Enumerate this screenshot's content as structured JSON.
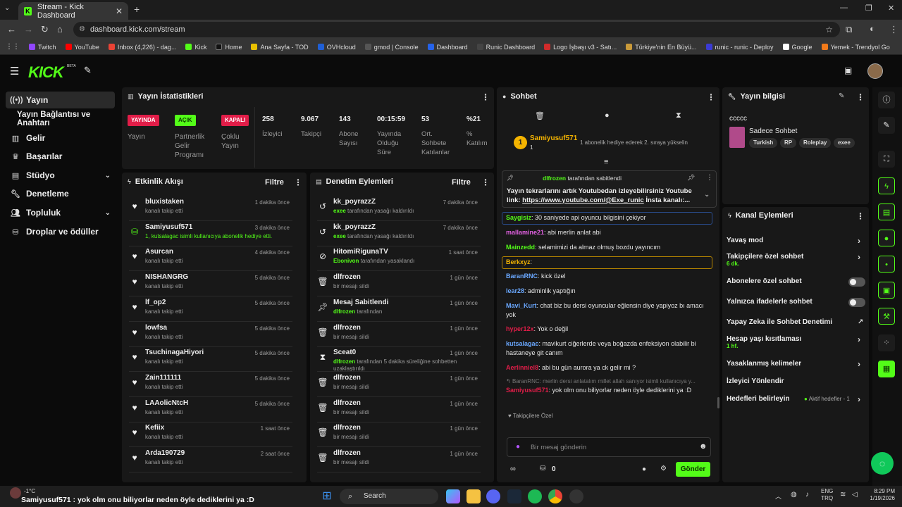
{
  "browser": {
    "tab_title": "Stream - Kick Dashboard",
    "url": "dashboard.kick.com/stream",
    "bookmarks": [
      "Twitch",
      "YouTube",
      "Inbox (4,226) - dag...",
      "Kick",
      "Home",
      "Ana Sayfa - TOD",
      "OVHcloud",
      "gmod | Console",
      "Dashboard",
      "Runic Dashboard",
      "Logo İşbaşı v3 - Satı...",
      "Türkiye'nin En Büyü...",
      "runic - runic - Deploy",
      "Google",
      "Yemek - Trendyol Go"
    ]
  },
  "app": {
    "logo": "KICK",
    "logo_badge": "BETA"
  },
  "sidebar": {
    "items": [
      {
        "label": "Yayın",
        "icon": "broadcast-icon"
      },
      {
        "label": "Yayın Bağlantısı ve Anahtarı",
        "icon": ""
      },
      {
        "label": "Gelir",
        "icon": "chart-icon"
      },
      {
        "label": "Başarılar",
        "icon": "trophy-icon"
      },
      {
        "label": "Stüdyo",
        "icon": "studio-icon"
      },
      {
        "label": "Denetleme",
        "icon": "wrench-icon"
      },
      {
        "label": "Topluluk",
        "icon": "community-icon"
      },
      {
        "label": "Droplar ve ödüller",
        "icon": "gift-icon"
      }
    ]
  },
  "stats": {
    "title": "Yayın İstatistikleri",
    "badges": [
      {
        "text": "YAYINDA",
        "label": "Yayın",
        "color": "#e11d48"
      },
      {
        "text": "AÇIK",
        "label": "Partnerlik Gelir Programı",
        "color": "#53fc18"
      },
      {
        "text": "KAPALI",
        "label": "Çoklu Yayın",
        "color": "#e11d48"
      }
    ],
    "values": [
      {
        "value": "258",
        "label": "İzleyici"
      },
      {
        "value": "9.067",
        "label": "Takipçi"
      },
      {
        "value": "143",
        "label": "Abone Sayısı"
      },
      {
        "value": "00:15:59",
        "label": "Yayında Olduğu Süre"
      },
      {
        "value": "53",
        "label": "Ort. Sohbete Katılanlar"
      },
      {
        "value": "%21",
        "label": "% Katılım"
      }
    ]
  },
  "activity": {
    "title": "Etkinlik Akışı",
    "filter": "Filtre",
    "rows": [
      {
        "name": "bluxistaken",
        "sub": "kanalı takip etti",
        "time": "1 dakika önce",
        "icon": "heart-icon"
      },
      {
        "name": "Samiyusuf571",
        "sub": "1, kutsalagac isimli kullanıcıya abonelik hediye etti.",
        "time": "3 dakika önce",
        "icon": "gift-icon"
      },
      {
        "name": "Asurcan",
        "sub": "kanalı takip etti",
        "time": "4 dakika önce",
        "icon": "heart-icon"
      },
      {
        "name": "NISHANGRG",
        "sub": "kanalı takip etti",
        "time": "5 dakika önce",
        "icon": "heart-icon"
      },
      {
        "name": "lf_op2",
        "sub": "kanalı takip etti",
        "time": "5 dakika önce",
        "icon": "heart-icon"
      },
      {
        "name": "lowfsa",
        "sub": "kanalı takip etti",
        "time": "5 dakika önce",
        "icon": "heart-icon"
      },
      {
        "name": "TsuchinagaHiyori",
        "sub": "kanalı takip etti",
        "time": "5 dakika önce",
        "icon": "heart-icon"
      },
      {
        "name": "Zain111111",
        "sub": "kanalı takip etti",
        "time": "5 dakika önce",
        "icon": "heart-icon"
      },
      {
        "name": "LAAolicNtcH",
        "sub": "kanalı takip etti",
        "time": "5 dakika önce",
        "icon": "heart-icon"
      },
      {
        "name": "Kefiix",
        "sub": "kanalı takip etti",
        "time": "1 saat önce",
        "icon": "heart-icon"
      },
      {
        "name": "Arda190729",
        "sub": "kanalı takip etti",
        "time": "2 saat önce",
        "icon": "heart-icon"
      }
    ]
  },
  "moderation": {
    "title": "Denetim Eylemleri",
    "filter": "Filtre",
    "rows": [
      {
        "name": "kk_poyrazzZ",
        "actor": "exee",
        "sub": "tarafından yasağı kaldırıldı",
        "time": "7 dakika önce",
        "icon": "undo-icon"
      },
      {
        "name": "kk_poyrazzZ",
        "actor": "exee",
        "sub": "tarafından yasağı kaldırıldı",
        "time": "7 dakika önce",
        "icon": "undo-icon"
      },
      {
        "name": "HitomiRigunaTV",
        "actor": "Ebonivon",
        "sub": "tarafından yasaklandı",
        "time": "1 saat önce",
        "icon": "ban-icon"
      },
      {
        "name": "dlfrozen",
        "actor": "",
        "sub": "bir mesajı sildi",
        "time": "1 gün önce",
        "icon": "trash-icon"
      },
      {
        "name": "Mesaj Sabitlendi",
        "actor": "dlfrozen",
        "sub": "tarafından",
        "time": "1 gün önce",
        "icon": "pin-icon"
      },
      {
        "name": "dlfrozen",
        "actor": "",
        "sub": "bir mesajı sildi",
        "time": "1 gün önce",
        "icon": "trash-icon"
      },
      {
        "name": "Sceat0",
        "actor": "dlfrozen",
        "sub": "tarafından 5 dakika süreliğine sohbetten uzaklaştırıldı",
        "time": "1 gün önce",
        "icon": "hourglass-icon"
      },
      {
        "name": "dlfrozen",
        "actor": "",
        "sub": "bir mesajı sildi",
        "time": "1 gün önce",
        "icon": "trash-icon"
      },
      {
        "name": "dlfrozen",
        "actor": "",
        "sub": "bir mesajı sildi",
        "time": "1 gün önce",
        "icon": "trash-icon"
      },
      {
        "name": "dlfrozen",
        "actor": "",
        "sub": "bir mesajı sildi",
        "time": "1 gün önce",
        "icon": "trash-icon"
      },
      {
        "name": "dlfrozen",
        "actor": "",
        "sub": "bir mesajı sildi",
        "time": "1 gün önce",
        "icon": "trash-icon"
      }
    ]
  },
  "chat": {
    "title": "Sohbet",
    "gifter": {
      "name": "Samiyusuf571",
      "count": "1",
      "text": "1 abonelik hediye ederek 2. sıraya yükselin"
    },
    "pinned": {
      "by": "dlfrozen",
      "by_suffix": "tarafından sabitlendi",
      "text": "Yayın tekrarlarını artık Youtubedan izleyebilirsiniz Youtube link:",
      "link": "https://www.youtube.com/@Exe_runic",
      "rest": "İnsta kanalı:..."
    },
    "messages": [
      {
        "user": "Saygisiz",
        "color": "#53fc18",
        "text": "30 saniyede api oyuncu bilgisini çekiyor"
      },
      {
        "user": "mallamine21",
        "color": "#e060e0",
        "text": "abi merlin anlat abi"
      },
      {
        "user": "Mainzedd",
        "color": "#53fc18",
        "text": "selamimizi da almaz olmuş bozdu yayıncım"
      },
      {
        "user": "Berkxyz",
        "color": "#f5b400",
        "text": ""
      },
      {
        "user": "BaranRNC",
        "color": "#6aa8ff",
        "text": "kick özel"
      },
      {
        "user": "lear28",
        "color": "#6aa8ff",
        "text": "adminlik yaptığın"
      },
      {
        "user": "Mavi_Kurt",
        "color": "#6aa8ff",
        "text": "chat biz bu dersi oyuncular eğlensin diye yapiyoz bı amacı yok"
      },
      {
        "user": "hyper12x",
        "color": "#e11d48",
        "text": "Yok o değil"
      },
      {
        "user": "kutsalagac",
        "color": "#6aa8ff",
        "text": "mavikurt ciğerlerde veya boğazda enfeksiyon olabilir bi hastaneye git canım"
      },
      {
        "user": "Aerlinniel8",
        "color": "#e11d48",
        "text": "abi bu gün aurora ya ck gelir mi ?"
      },
      {
        "user": "Samiyusuf571",
        "color": "#e11d48",
        "text": "yok olm onu biliyorlar neden öyle dediklerini ya :D",
        "reply": "BaranRNC: merlin dersi anlatalım millet allah sanıyor isimli kullanıcıya y..."
      }
    ],
    "emote_label": "Takipçilere Özel",
    "input_placeholder": "Bir mesaj gönderin",
    "points": "0",
    "send_label": "Gönder"
  },
  "stream_info": {
    "title": "Yayın bilgisi",
    "stream_title": "ccccc",
    "category": "Sadece Sohbet",
    "tags": [
      "Turkish",
      "RP",
      "Roleplay",
      "exee"
    ]
  },
  "channel_actions": {
    "title": "Kanal Eylemleri",
    "items": [
      {
        "label": "Yavaş mod",
        "sub": "",
        "control": "chevron"
      },
      {
        "label": "Takipçilere özel sohbet",
        "sub": "6 dk.",
        "control": "chevron"
      },
      {
        "label": "Abonelere özel sohbet",
        "sub": "",
        "control": "toggle"
      },
      {
        "label": "Yalnızca ifadelerle sohbet",
        "sub": "",
        "control": "toggle"
      },
      {
        "label": "Yapay Zeka ile Sohbet Denetimi",
        "sub": "",
        "control": "external"
      },
      {
        "label": "Hesap yaşı kısıtlaması",
        "sub": "1 hf.",
        "control": "chevron"
      },
      {
        "label": "Yasaklanmış kelimeler",
        "sub": "",
        "control": "chevron"
      },
      {
        "label": "İzleyici Yönlendir",
        "sub": "",
        "control": "none"
      },
      {
        "label": "Hedefleri belirleyin",
        "sub": "",
        "control": "chevron",
        "status": "Aktif hedefler - 1"
      }
    ]
  },
  "taskbar": {
    "weather": "-1°C",
    "notification": "Samiyusuf571 : yok olm onu biliyorlar neden öyle dediklerini ya :D",
    "search": "Search",
    "lang1": "ENG",
    "lang2": "TRQ",
    "time": "8:29 PM",
    "date": "1/19/2026"
  }
}
